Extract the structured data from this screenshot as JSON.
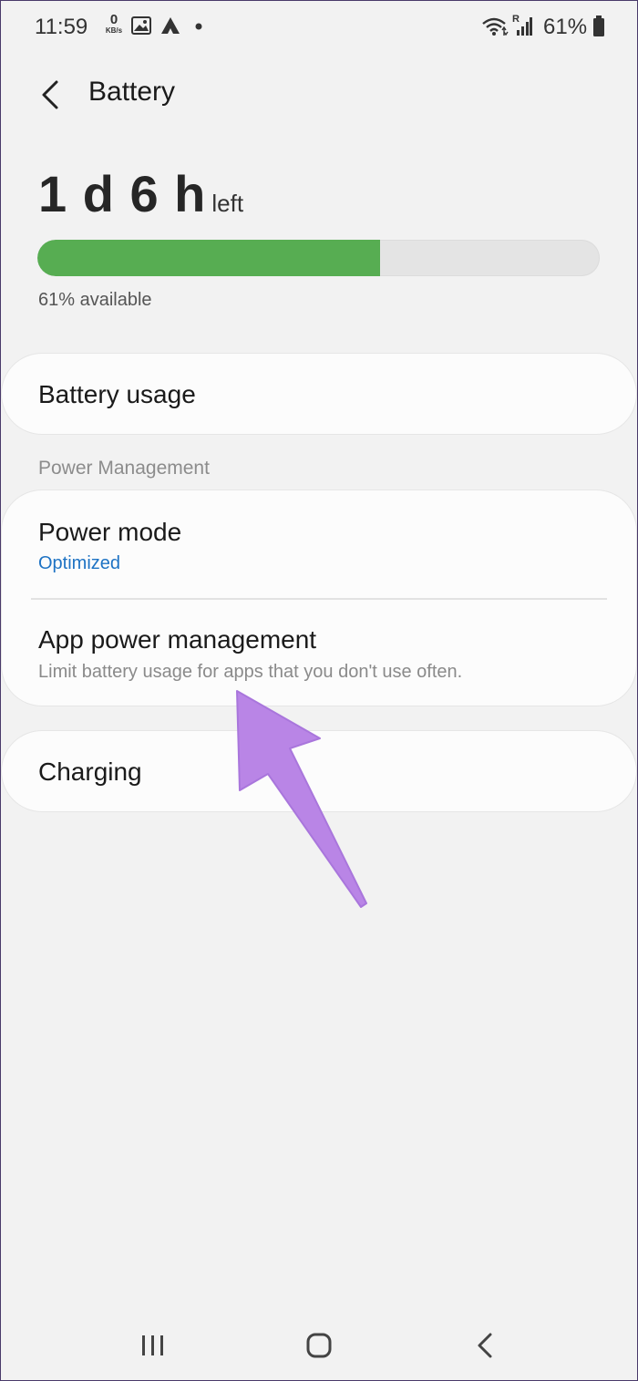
{
  "status_bar": {
    "time": "11:59",
    "data_speed_value": "0",
    "data_speed_unit": "KB/s",
    "roaming_indicator": "R",
    "battery_percent": "61%",
    "icons": [
      "image-notification-icon",
      "app-notification-icon",
      "dot-icon",
      "wifi-icon",
      "signal-icon",
      "battery-icon"
    ]
  },
  "header": {
    "title": "Battery"
  },
  "summary": {
    "time_left_value": "1 d 6 h",
    "time_left_suffix": "left",
    "available_text": "61% available",
    "battery_level": 0.61,
    "bar_fill_color": "#57ad52"
  },
  "battery_usage": {
    "label": "Battery usage"
  },
  "power_management": {
    "section_title": "Power Management",
    "items": [
      {
        "label": "Power mode",
        "subtitle": "Optimized"
      },
      {
        "label": "App power management",
        "subtitle": "Limit battery usage for apps that you don't use often."
      }
    ]
  },
  "charging": {
    "label": "Charging"
  },
  "annotation": {
    "arrow_color": "#b985e6"
  },
  "nav_bar": {
    "icons": [
      "recent-apps-icon",
      "home-icon",
      "back-icon"
    ]
  }
}
